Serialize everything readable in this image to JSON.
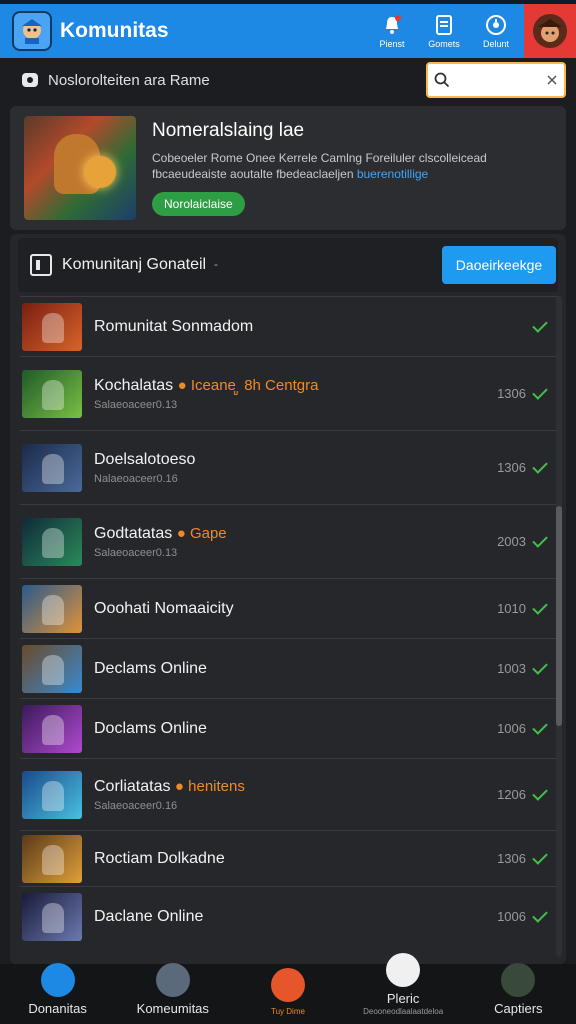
{
  "header": {
    "title": "Komunitas",
    "actions": [
      {
        "label": "Pienst",
        "icon": "bell-icon"
      },
      {
        "label": "Gomets",
        "icon": "document-icon"
      },
      {
        "label": "Delunt",
        "icon": "compass-icon"
      }
    ]
  },
  "subbar": {
    "breadcrumb": "Noslorolteiten ara Rame",
    "search_placeholder": ""
  },
  "featured": {
    "title": "Nomeralslaing lae",
    "desc_line1": "Cobeoeler Rome Onee Kerrele Camlng Foreiluler clscolleicead",
    "desc_line2": "fbcaeudeaiste aoutalte fbedeaclaeljen ",
    "desc_highlight": "buerenotillige",
    "button": "Norolaiclaise"
  },
  "panel": {
    "title": "Komunitanj Gonateil",
    "caret": "-",
    "button": "Daoeirkeekge"
  },
  "rows": [
    {
      "title": "Romunitat Sonmadom",
      "tag": "",
      "sub": "",
      "count": "",
      "colors": [
        "#7a1e12",
        "#d8642a"
      ]
    },
    {
      "title": "Kochalatas ",
      "tag": "● Iceane ູ 8h Centgra",
      "sub": "Salaeoaceer0.13",
      "count": "1306",
      "colors": [
        "#1f5a2a",
        "#7bc043"
      ]
    },
    {
      "title": "Doelsalotoeso",
      "tag": "",
      "sub": "Nalaeoaceer0.16",
      "count": "1306",
      "colors": [
        "#1b2a4a",
        "#4a6a9a"
      ]
    },
    {
      "title": "Godtatatas ",
      "tag": "● Gape",
      "sub": "Salaeoaceer0.13",
      "count": "2003",
      "colors": [
        "#0f2a3a",
        "#2b8a5a"
      ]
    },
    {
      "title": "Ooohati Nomaaicity",
      "tag": "",
      "sub": "",
      "count": "1010",
      "colors": [
        "#2a5a8a",
        "#e0923a"
      ]
    },
    {
      "title": "Declams Online",
      "tag": "",
      "sub": "",
      "count": "1003",
      "colors": [
        "#6a4a2a",
        "#3a8ad0"
      ]
    },
    {
      "title": "Doclams Online",
      "tag": "",
      "sub": "",
      "count": "1006",
      "colors": [
        "#3a1a5a",
        "#b04ad0"
      ]
    },
    {
      "title": "Corliatatas ",
      "tag": "● henitens",
      "sub": "Salaeoaceer0.16",
      "count": "1206",
      "colors": [
        "#1a4a8a",
        "#4ac0e0"
      ]
    },
    {
      "title": "Roctiam Dolkadne",
      "tag": "",
      "sub": "",
      "count": "1306",
      "colors": [
        "#5a3a1a",
        "#e0a03a"
      ]
    },
    {
      "title": "Daclane Online",
      "tag": "",
      "sub": "",
      "count": "1006",
      "colors": [
        "#1a1a3a",
        "#6a7ab0"
      ]
    }
  ],
  "bottom_nav": [
    {
      "label": "Donanitas",
      "sub": "",
      "icon": "home-icon",
      "color": "#1e88e5"
    },
    {
      "label": "Komeumitas",
      "sub": "",
      "icon": "community-icon",
      "color": "#5a6a7a"
    },
    {
      "label": "",
      "sub": "Tuy Dime",
      "icon": "fire-icon",
      "color": "#e6562a"
    },
    {
      "label": "Pleric",
      "sub": "Deooneodlaalaatdeloa",
      "icon": "chat-icon",
      "color": "#f0f0f0"
    },
    {
      "label": "Captiers",
      "sub": "",
      "icon": "profile-icon",
      "color": "#3a4a3a"
    }
  ]
}
